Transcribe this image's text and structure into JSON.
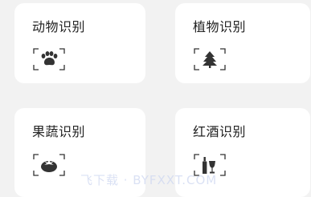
{
  "cards": [
    {
      "title": "动物识别",
      "icon": "paw-icon"
    },
    {
      "title": "植物识别",
      "icon": "tree-icon"
    },
    {
      "title": "果蔬识别",
      "icon": "tomato-icon"
    },
    {
      "title": "红酒识别",
      "icon": "wine-icon"
    }
  ],
  "watermark": "飞下载 · BYFXXT.COM",
  "colors": {
    "background": "#f2f2f2",
    "card": "#ffffff",
    "text": "#222222",
    "icon": "#333333"
  }
}
